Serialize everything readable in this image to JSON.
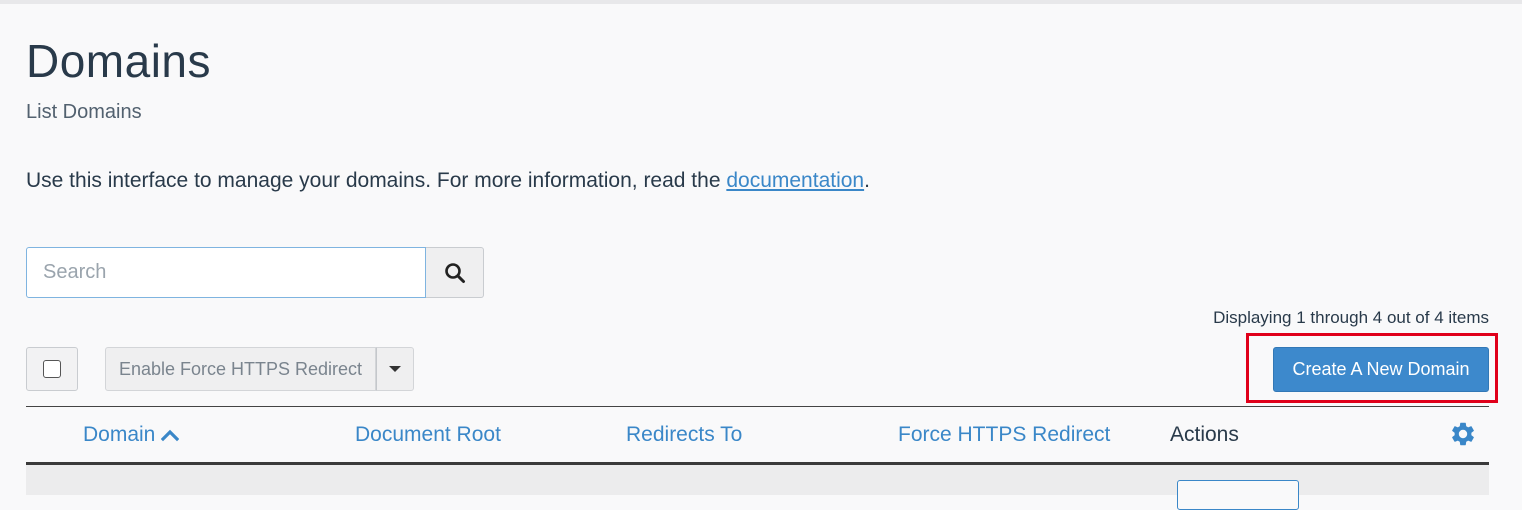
{
  "header": {
    "title": "Domains",
    "subtitle": "List Domains"
  },
  "intro": {
    "text": "Use this interface to manage your domains. For more information, read the ",
    "link": "documentation",
    "suffix": "."
  },
  "search": {
    "placeholder": "Search",
    "value": "",
    "button_icon": "search-icon"
  },
  "pagination": {
    "summary": "Displaying 1 through 4 out of 4 items"
  },
  "toolbar": {
    "bulk_action_label": "Enable Force HTTPS Redirect",
    "bulk_caret_icon": "caret-down-icon",
    "create_label": "Create A New Domain",
    "highlight_color": "#e0001a"
  },
  "table": {
    "columns": [
      {
        "label": "Domain",
        "sort_icon": "chevron-up-icon"
      },
      {
        "label": "Document Root"
      },
      {
        "label": "Redirects To"
      },
      {
        "label": "Force HTTPS Redirect"
      },
      {
        "label": "Actions"
      }
    ],
    "settings_icon": "gear-icon"
  },
  "colors": {
    "accent": "#3a87c8",
    "primary_button": "#3d89cc",
    "text": "#293a4a"
  }
}
